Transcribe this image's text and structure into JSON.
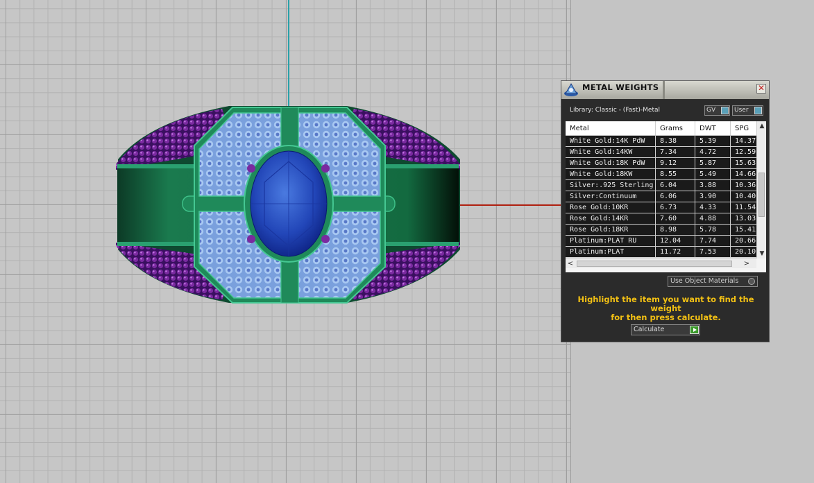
{
  "panel": {
    "title": "METAL WEIGHTS",
    "close_glyph": "✕",
    "library_label": "Library: Classic - (Fast)-Metal",
    "gv_label": "GV",
    "user_label": "User",
    "columns": [
      "Metal",
      "Grams",
      "DWT",
      "SPG"
    ],
    "rows": [
      [
        "White Gold:14K PdW",
        "8.38",
        "5.39",
        "14.37"
      ],
      [
        "White Gold:14KW",
        "7.34",
        "4.72",
        "12.59"
      ],
      [
        "White Gold:18K PdW",
        "9.12",
        "5.87",
        "15.63"
      ],
      [
        "White Gold:18KW",
        "8.55",
        "5.49",
        "14.66"
      ],
      [
        "Silver:.925 Sterling",
        "6.04",
        "3.88",
        "10.36"
      ],
      [
        "Silver:Continuum",
        "6.06",
        "3.90",
        "10.40"
      ],
      [
        "Rose Gold:10KR",
        "6.73",
        "4.33",
        "11.54"
      ],
      [
        "Rose Gold:14KR",
        "7.60",
        "4.88",
        "13.03"
      ],
      [
        "Rose Gold:18KR",
        "8.98",
        "5.78",
        "15.41"
      ],
      [
        "Platinum:PLAT RU",
        "12.04",
        "7.74",
        "20.66"
      ],
      [
        "Platinum:PLAT",
        "11.72",
        "7.53",
        "20.10"
      ]
    ],
    "scroll_up": "▲",
    "scroll_down": "▼",
    "scroll_left": "<",
    "scroll_right": ">",
    "use_object_label": "Use Object Materials",
    "hint_line1": "Highlight the item you want to find the weight",
    "hint_line2": "for then press calculate.",
    "calculate_label": "Calculate"
  },
  "colors": {
    "hint_text": "#f2c014",
    "panel_bg": "#2b2b2b",
    "metal_green": "#1f8a5a",
    "sapphire": "#2a4fc0",
    "amethyst": "#7a2aa0",
    "diamond": "#9cc0ee",
    "axis_x": "#b02010",
    "axis_y": "#2aa0a8"
  },
  "icons": {
    "logo": "rhino-logo-icon",
    "close": "close-icon",
    "calculate": "play-arrow-icon"
  }
}
